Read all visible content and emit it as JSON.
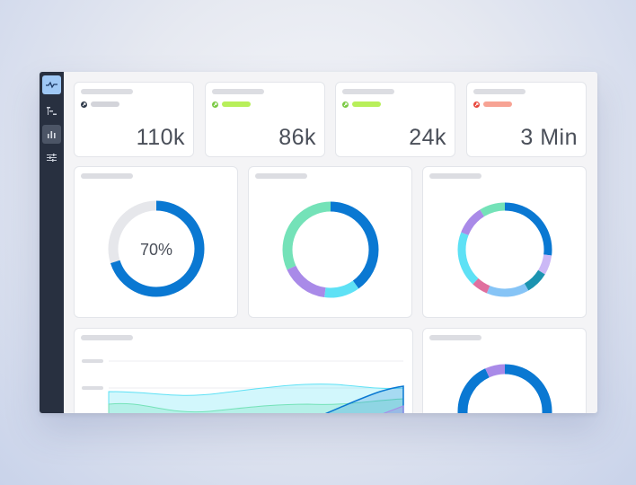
{
  "sidebar": {
    "items": [
      {
        "icon": "pulse-icon",
        "state": "active"
      },
      {
        "icon": "hierarchy-icon",
        "state": "default"
      },
      {
        "icon": "bar-chart-icon",
        "state": "selected"
      },
      {
        "icon": "sliders-icon",
        "state": "default"
      }
    ]
  },
  "stats": [
    {
      "value": "110k",
      "status_color": "#2f3a4a",
      "pill_color": "#d3d4da"
    },
    {
      "value": "86k",
      "status_color": "#7ac943",
      "pill_color": "#b8ef5a"
    },
    {
      "value": "24k",
      "status_color": "#7ac943",
      "pill_color": "#b8ef5a"
    },
    {
      "value": "3 Min",
      "status_color": "#e8473c",
      "pill_color": "#f7a394"
    }
  ],
  "progress": {
    "label": "70%",
    "value": 0.7,
    "color": "#0a78d2",
    "track": "#e6e7eb"
  },
  "chart_data": [
    {
      "type": "pie",
      "values": [
        40,
        12,
        16,
        32
      ],
      "colors": [
        "#0a78d2",
        "#5ee1f5",
        "#a98ae8",
        "#74e2b8"
      ]
    },
    {
      "type": "pie",
      "values": [
        24,
        6,
        7,
        13,
        5,
        17,
        9,
        8
      ],
      "colors": [
        "#0a78d2",
        "#cbb8f6",
        "#1b93b0",
        "#86c4f6",
        "#e06f9e",
        "#5ee1f5",
        "#a98ae8",
        "#74e2b8"
      ]
    },
    {
      "type": "pie",
      "values": [
        93,
        7
      ],
      "colors": [
        "#0a78d2",
        "#a98ae8"
      ]
    }
  ],
  "area": {
    "colors": [
      "#0a78d2",
      "#5ee1f5",
      "#74e2b8",
      "#a98ae8"
    ]
  }
}
